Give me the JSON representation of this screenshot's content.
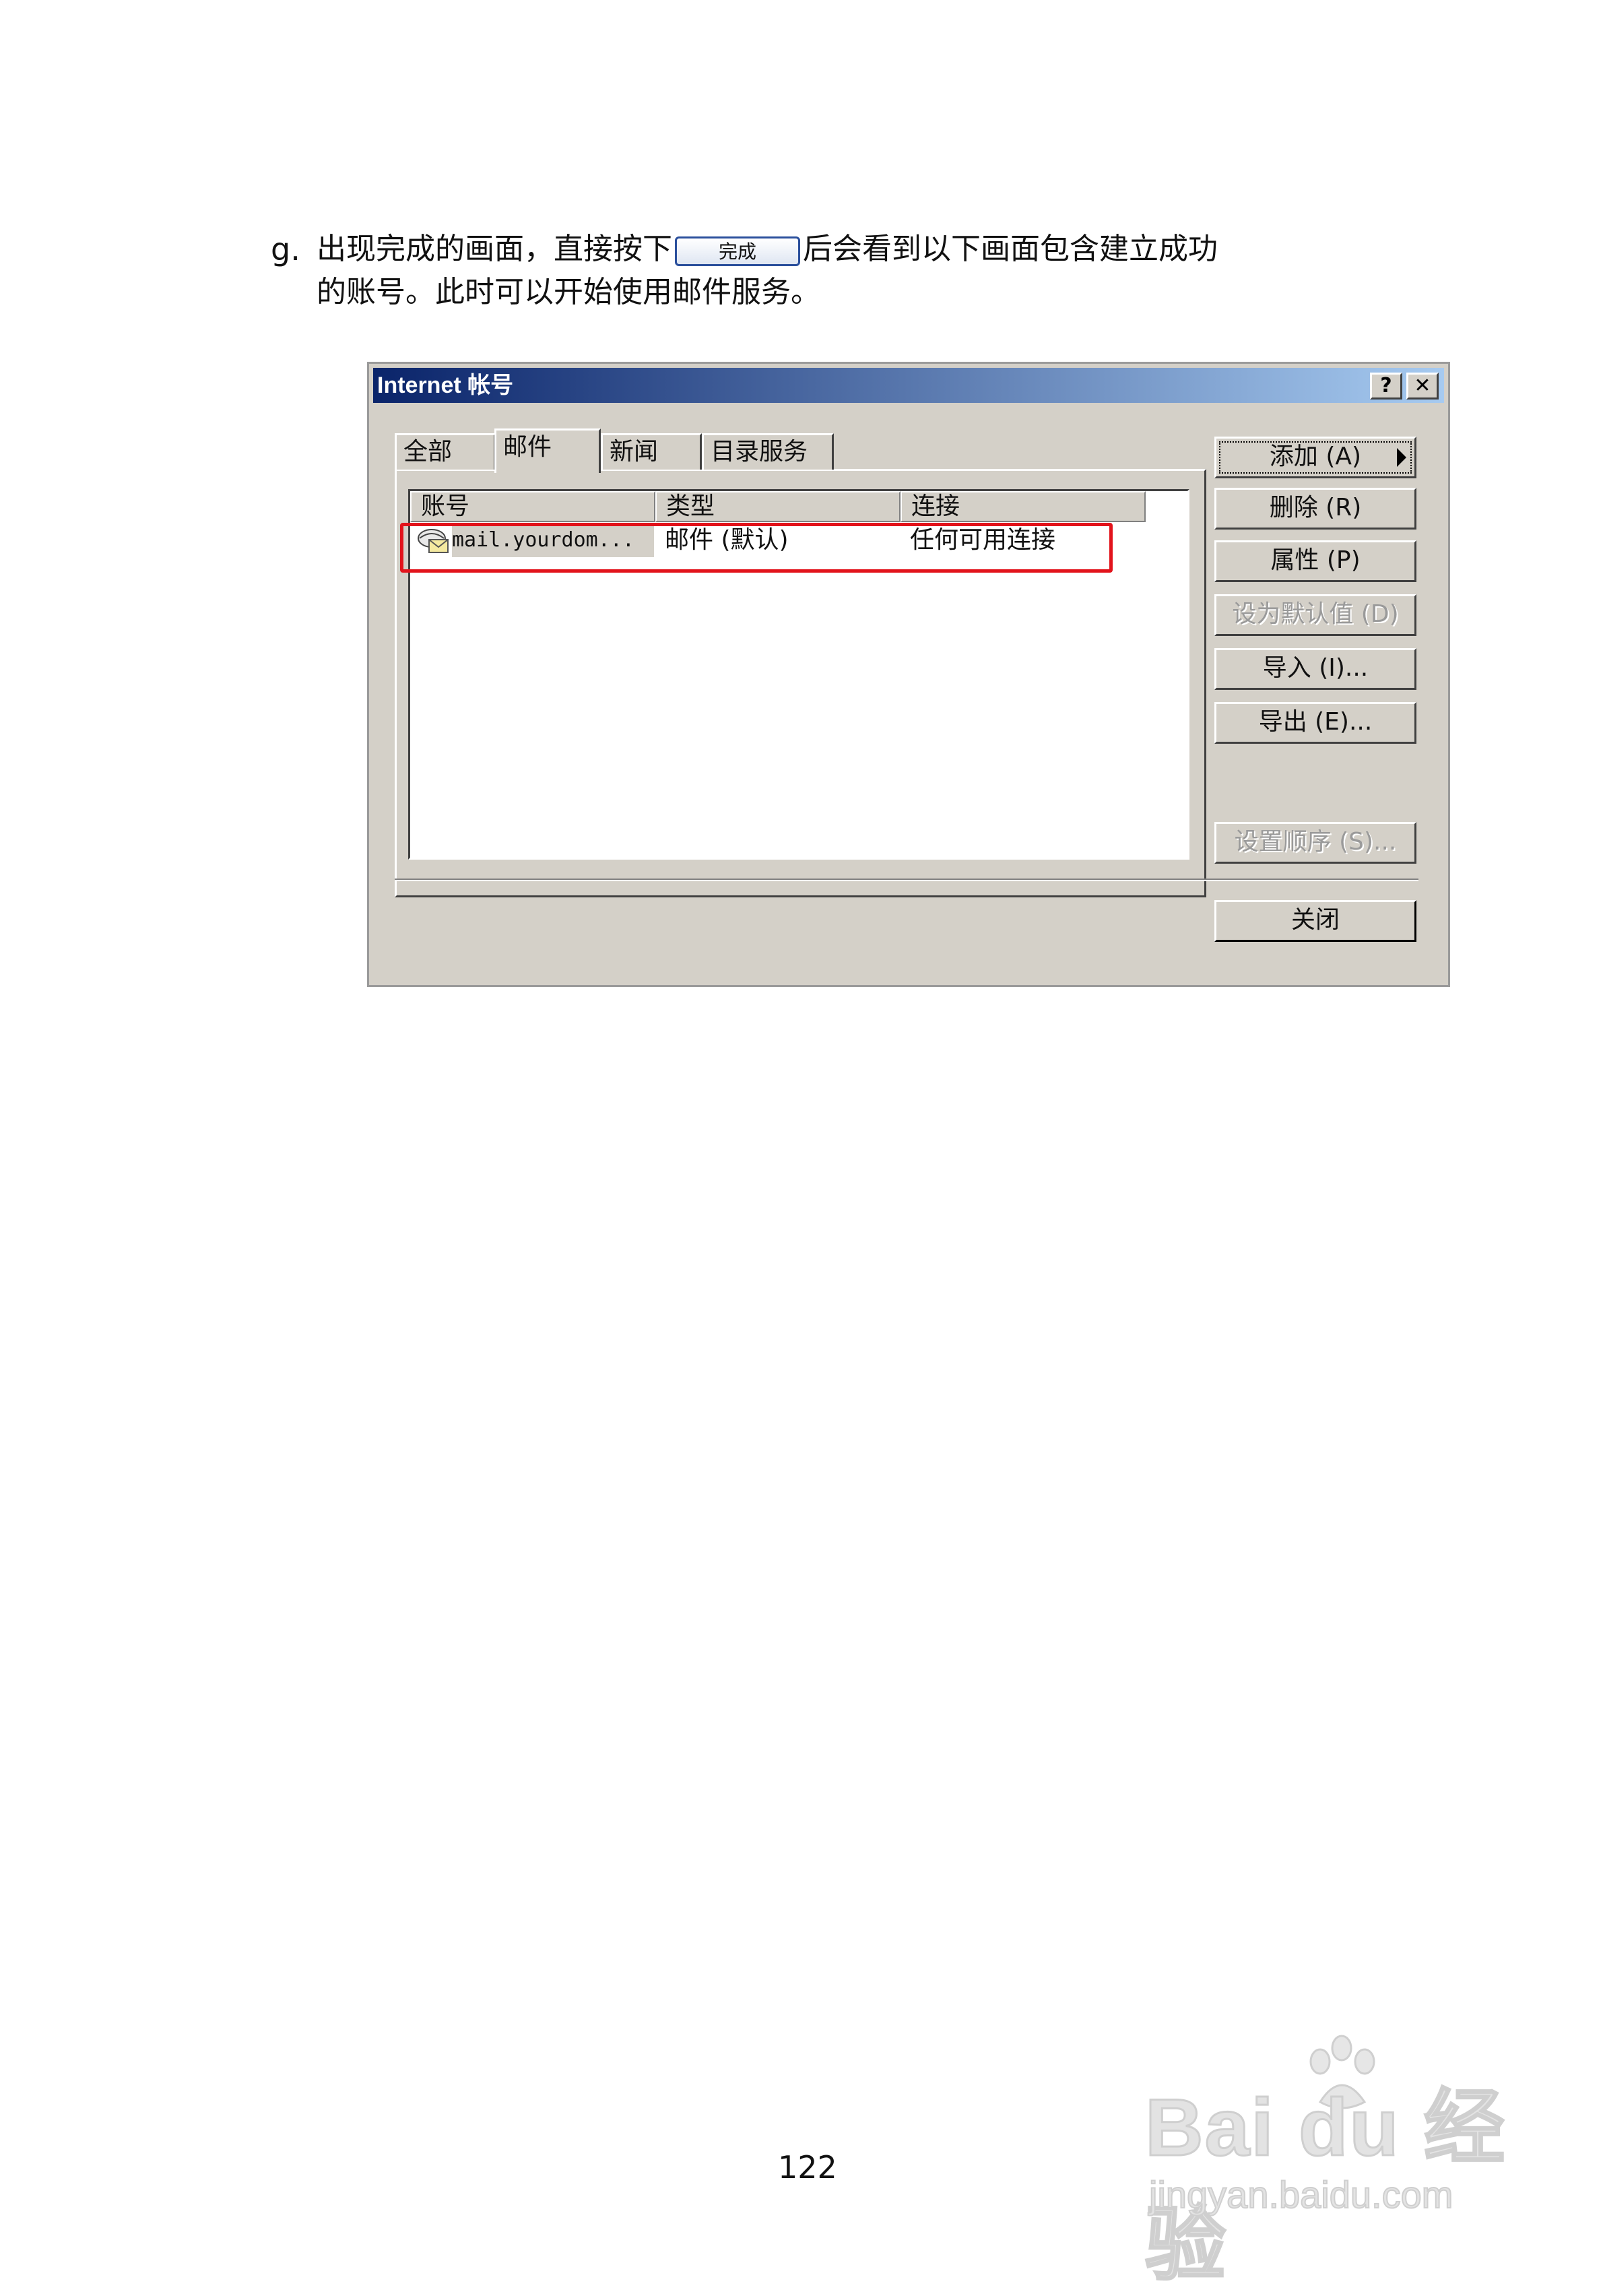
{
  "instruction": {
    "step": "g.",
    "text_before": "出现完成的画面，直接按下",
    "button_label": "完成",
    "text_after": "后会看到以下画面包含建立成功",
    "line2": "的账号。此时可以开始使用邮件服务。"
  },
  "dialog": {
    "title": "Internet 帐号",
    "help_glyph": "?",
    "close_glyph": "✕",
    "tabs": [
      {
        "label": "全部",
        "active": false
      },
      {
        "label": "邮件",
        "active": true
      },
      {
        "label": "新闻",
        "active": false
      },
      {
        "label": "目录服务",
        "active": false
      }
    ],
    "columns": [
      "账号",
      "类型",
      "连接"
    ],
    "rows": [
      {
        "account": "mail.yourdom...",
        "type": "邮件 (默认)",
        "connection": "任何可用连接"
      }
    ],
    "side_buttons": [
      {
        "label": "添加 (A)",
        "enabled": true
      },
      {
        "label": "删除 (R)",
        "enabled": true
      },
      {
        "label": "属性 (P)",
        "enabled": true
      },
      {
        "label": "设为默认值 (D)",
        "enabled": false
      },
      {
        "label": "导入 (I)...",
        "enabled": true
      },
      {
        "label": "导出 (E)...",
        "enabled": true
      },
      {
        "label": "设置顺序 (S)...",
        "enabled": false
      }
    ],
    "close_button": "关闭",
    "colors": {
      "highlight": "#e2131b",
      "title_gradient_start": "#0a246a",
      "title_gradient_end": "#a6caf0"
    }
  },
  "page_number": "122",
  "watermark": {
    "brand": "Bai du 经验",
    "url": "jingyan.baidu.com"
  }
}
